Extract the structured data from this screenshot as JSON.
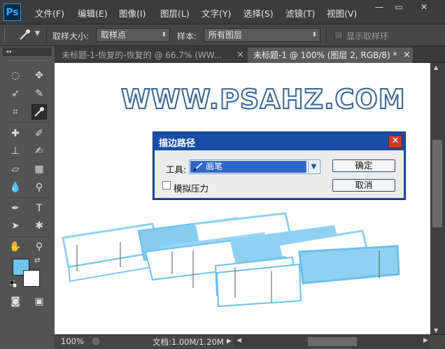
{
  "app": {
    "logo": "Ps"
  },
  "menu": [
    "文件(F)",
    "编辑(E)",
    "图像(I)",
    "图层(L)",
    "文字(Y)",
    "选择(S)",
    "滤镜(T)",
    "视图(V)"
  ],
  "window_buttons": {
    "minimize": "—",
    "maximize": "▭",
    "close": "✕"
  },
  "options_bar": {
    "sample_size_label": "取样大小:",
    "sample_size_value": "取样点",
    "sample_label": "样本:",
    "sample_value": "所有图层",
    "show_ring_label": "显示取样环"
  },
  "tabs": [
    {
      "label": "未标题-1-恢复的-恢复的 @ 66.7% (WW...",
      "close": "×",
      "active": false
    },
    {
      "label": "未标题-1 @ 100% (图层 2, RGB/8) *",
      "close": "×",
      "active": true
    }
  ],
  "canvas": {
    "headline": "WWW.PSAHZ.COM"
  },
  "dialog": {
    "title": "描边路径",
    "tool_label": "工具:",
    "tool_value": "画笔",
    "simulate_pressure_label": "模拟压力",
    "ok_label": "确定",
    "cancel_label": "取消",
    "close": "✕"
  },
  "status": {
    "zoom": "100%",
    "doc": "文档:1.00M/1.20M"
  },
  "colors": {
    "foreground": "#6ec6f0",
    "background": "#ffffff",
    "dialog_titlebar": "#1a4ea6",
    "accent": "#31a8ff"
  }
}
